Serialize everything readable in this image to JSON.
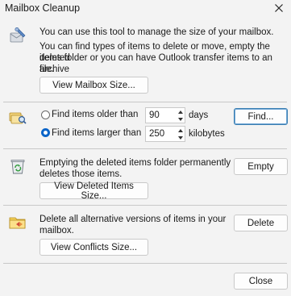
{
  "window": {
    "title": "Mailbox Cleanup"
  },
  "intro": {
    "line1": "You can use this tool to manage the size of your mailbox.",
    "line2": "You can find types of items to delete or move, empty the deleted",
    "line3": "items folder or you can have Outlook transfer items to an archive",
    "line4": "file.",
    "view_size_button": "View Mailbox Size..."
  },
  "find": {
    "older_label": "Find items older than",
    "older_value": "90",
    "older_unit": "days",
    "larger_label": "Find items larger than",
    "larger_value": "250",
    "larger_unit": "kilobytes",
    "selected_option": "larger",
    "find_button": "Find..."
  },
  "deleted": {
    "line1": "Emptying the deleted items folder permanently",
    "line2": "deletes those items.",
    "empty_button": "Empty",
    "view_button": "View Deleted Items Size..."
  },
  "conflicts": {
    "line1": "Delete all alternative versions of items in your",
    "line2": "mailbox.",
    "delete_button": "Delete",
    "view_button": "View Conflicts Size..."
  },
  "footer": {
    "close_button": "Close"
  }
}
